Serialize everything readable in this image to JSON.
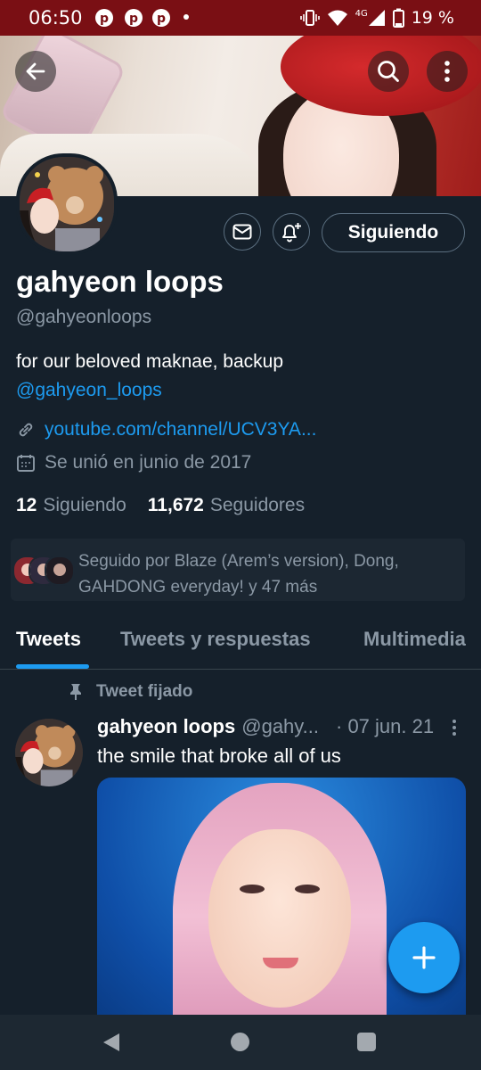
{
  "status_bar": {
    "time": "06:50",
    "network": "4G",
    "battery": "19 %",
    "icons": [
      "pinterest-icon",
      "pinterest-icon",
      "pinterest-icon",
      "dot-icon",
      "vibrate-icon",
      "wifi-icon",
      "signal-icon",
      "battery-icon"
    ]
  },
  "header": {
    "back_icon": "arrow-left-icon",
    "search_icon": "search-icon",
    "more_icon": "more-vertical-icon"
  },
  "profile": {
    "name": "gahyeon loops",
    "handle": "@gahyeonloops",
    "bio_text": "for our beloved maknae, backup",
    "bio_link": "@gahyeon_loops",
    "website": "youtube.com/channel/UCV3YA...",
    "joined": "Se unió en junio de 2017",
    "following_count": "12",
    "following_label": "Siguiendo",
    "followers_count": "11,672",
    "followers_label": "Seguidores",
    "follow_button": "Siguiendo",
    "icons": [
      "mail-icon",
      "bell-plus-icon",
      "link-icon",
      "calendar-icon"
    ]
  },
  "followed_by": {
    "line1": "Seguido por Blaze (Arem’s version), Dong,",
    "line2": "GAHDONG everyday! y 47 más"
  },
  "tabs": [
    {
      "label": "Tweets",
      "active": true
    },
    {
      "label": "Tweets y respuestas",
      "active": false
    },
    {
      "label": "Multimedia",
      "active": false
    }
  ],
  "pinned_tweet": {
    "pinned_label": "Tweet fijado",
    "author_name": "gahyeon loops",
    "author_handle": "@gahy...",
    "date": "· 07 jun. 21",
    "text": "the smile that broke all of us"
  },
  "colors": {
    "background": "#15202b",
    "accent": "#1d9bf0",
    "secondary_text": "#8b98a5",
    "status_bar": "#7a0f14"
  }
}
